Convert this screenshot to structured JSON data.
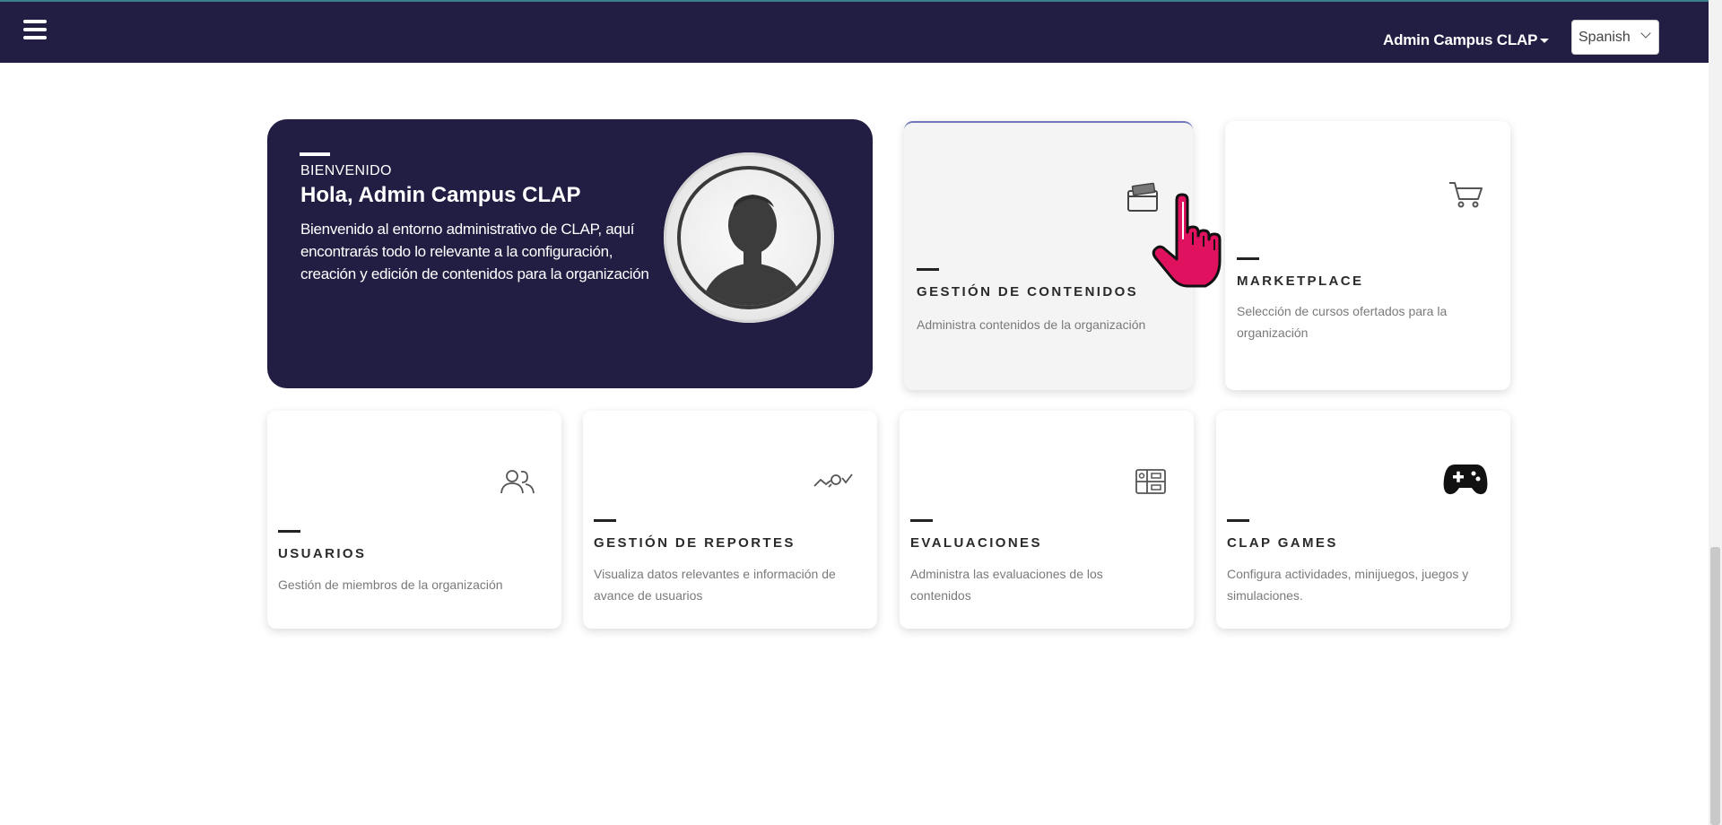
{
  "header": {
    "menu_icon": "hamburger-menu-icon",
    "user_label": "Admin Campus CLAP",
    "language": "Spanish"
  },
  "welcome": {
    "eyebrow": "BIENVENIDO",
    "greeting": "Hola, Admin Campus CLAP",
    "description": "Bienvenido al entorno administrativo de CLAP, aquí encontrarás todo lo relevante a la configuración, creación y edición de contenidos para la organización",
    "avatar_icon": "user-avatar-icon"
  },
  "modules": {
    "contenidos": {
      "title": "GESTIÓN DE CONTENIDOS",
      "text": "Administra contenidos de la organización",
      "icon": "folder-icon"
    },
    "marketplace": {
      "title": "MARKETPLACE",
      "text": "Selección de cursos ofertados para la organización",
      "icon": "cart-icon"
    },
    "usuarios": {
      "title": "USUARIOS",
      "text": "Gestión de miembros de la organización",
      "icon": "users-icon"
    },
    "reportes": {
      "title": "GESTIÓN DE REPORTES",
      "text": "Visualiza datos relevantes e información de avance de usuarios",
      "icon": "report-icon"
    },
    "evaluaciones": {
      "title": "EVALUACIONES",
      "text": "Administra las evaluaciones de los contenidos",
      "icon": "evaluation-icon"
    },
    "games": {
      "title": "CLAP GAMES",
      "text": "Configura actividades, minijuegos, juegos y simulaciones.",
      "icon": "gamepad-icon"
    }
  },
  "colors": {
    "navy": "#221e43",
    "cursor": "#e0115f"
  }
}
